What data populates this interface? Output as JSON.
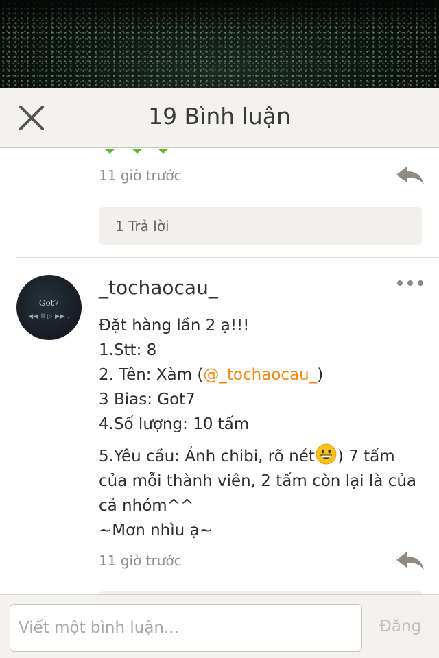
{
  "header": {
    "title": "19 Bình luận",
    "close_icon": "close-icon"
  },
  "previous_comment": {
    "time": "11 giờ trước",
    "replies_label": "1 Trả lời",
    "reply_icon": "reply-arrow-icon"
  },
  "comment": {
    "username": "_tochaocau_",
    "avatar_text_top": "Got7",
    "avatar_text_bottom": "◀◀ II ▷ ▶▶ .",
    "line1": "Đặt hàng lần 2 ạ!!!",
    "line2": "1.Stt: 8",
    "line3_prefix": "2. Tên: Xàm (",
    "line3_mention": "@_tochaocau_",
    "line3_suffix": ")",
    "line4": "3 Bias: Got7",
    "line5": "4.Số lượng: 10 tấm",
    "line6_prefix": "5.Yêu cầu: Ảnh chibi, rõ nét",
    "line6_emoji": "grinning-face-emoji",
    "line6_rest": ") 7 tấm của mỗi thành viên, 2 tấm còn lại là của cả nhóm^^",
    "line7": " ~Mơn nhìu ạ~",
    "time": "11 giờ trước",
    "more_icon": "more-dots-icon"
  },
  "composer": {
    "placeholder": "Viết một bình luận...",
    "value": "",
    "post_label": "Đăng"
  },
  "colors": {
    "mention": "#f08a1a",
    "header_bg": "#f4f2ee",
    "chevron_green": "#5cb82e"
  }
}
